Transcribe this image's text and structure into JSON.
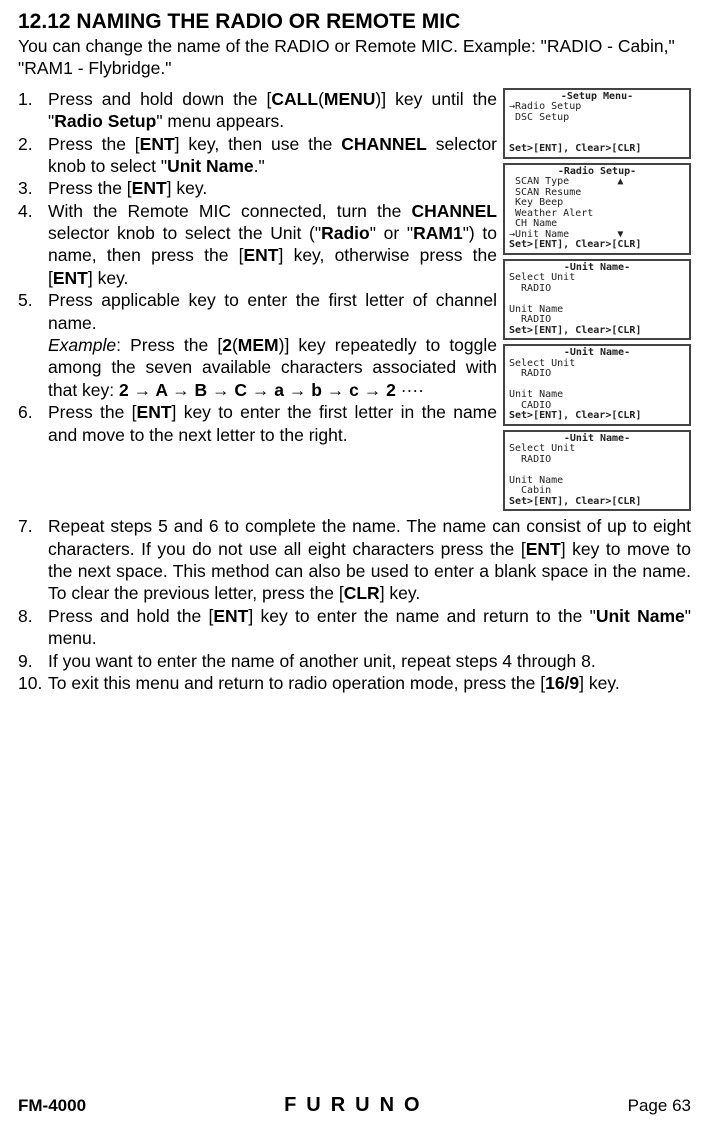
{
  "section": {
    "number": "12.12",
    "title": "NAMING THE RADIO OR REMOTE MIC"
  },
  "intro": "You can change the name of the RADIO or Remote MIC. Example: \"RADIO - Cabin,\" \"RAM1 - Flybridge.\"",
  "steps": {
    "s1a": "Press and hold down the [",
    "s1b": "CALL",
    "s1c": "(",
    "s1d": "MENU",
    "s1e": ")] key until the \"",
    "s1f": "Radio Setup",
    "s1g": "\" menu appears.",
    "s2a": "Press the [",
    "s2b": "ENT",
    "s2c": "] key, then use the ",
    "s2d": "CHANNEL",
    "s2e": " selector knob to select \"",
    "s2f": "Unit Name",
    "s2g": ".\"",
    "s3a": "Press the [",
    "s3b": "ENT",
    "s3c": "] key.",
    "s4a": "With the Remote MIC connected, turn the ",
    "s4b": "CHANNEL",
    "s4c": " selector knob to select the Unit (\"",
    "s4d": "Radio",
    "s4e": "\" or \"",
    "s4f": "RAM1",
    "s4g": "\") to name, then press the [",
    "s4h": "ENT",
    "s4i": "] key, otherwise press the [",
    "s4j": "ENT",
    "s4k": "] key.",
    "s5a": "Press applicable key to enter the first letter of channel name.",
    "s5ex1": "Example",
    "s5ex2": ": Press the [",
    "s5ex3": "2",
    "s5ex4": "(",
    "s5ex5": "MEM",
    "s5ex6": ")] key repeatedly to toggle among the seven available characters associated with that key: ",
    "s5seq": "2 → A → B → C → a → b → c → 2",
    "s5dots": " ····",
    "s6a": "Press the [",
    "s6b": "ENT",
    "s6c": "] key to enter the first letter in the name and move to the next letter to the right.",
    "s7a": "Repeat steps 5 and 6 to complete the name. The name can consist of up to eight characters. If you do not use all eight characters press the [",
    "s7b": "ENT",
    "s7c": "] key to move to the next space. This method can also be used to enter a blank space in the name. To clear the previous letter, press the [",
    "s7d": "CLR",
    "s7e": "] key.",
    "s8a": "Press and hold the [",
    "s8b": "ENT",
    "s8c": "] key to enter the name and return to the \"",
    "s8d": "Unit Name",
    "s8e": "\" menu.",
    "s9": "If you want to enter the name of another unit, repeat steps 4 through 8.",
    "s10a": "To exit this menu and return to radio operation mode, press the [",
    "s10b": "16/9",
    "s10c": "] key."
  },
  "screens": {
    "sc1": {
      "title": "-Setup Menu-",
      "lines": "→Radio Setup\n DSC Setup\n\n",
      "footer": "Set>[ENT], Clear>[CLR]"
    },
    "sc2": {
      "title": "-Radio Setup-",
      "lines": " SCAN Type        ▲\n SCAN Resume\n Key Beep\n Weather Alert\n CH Name\n→Unit Name        ▼",
      "footer": "Set>[ENT], Clear>[CLR]"
    },
    "sc3": {
      "title": "-Unit Name-",
      "lines": "Select Unit\n  RADIO\n\nUnit Name\n  RADIO",
      "footer": "Set>[ENT], Clear>[CLR]"
    },
    "sc4": {
      "title": "-Unit Name-",
      "lines": "Select Unit\n  RADIO\n\nUnit Name\n  CADIO",
      "footer": "Set>[ENT], Clear>[CLR]"
    },
    "sc5": {
      "title": "-Unit Name-",
      "lines": "Select Unit\n  RADIO\n\nUnit Name\n  Cabin",
      "footer": "Set>[ENT], Clear>[CLR]"
    }
  },
  "footer": {
    "model": "FM-4000",
    "logo": "FURUNO",
    "page": "Page 63"
  }
}
